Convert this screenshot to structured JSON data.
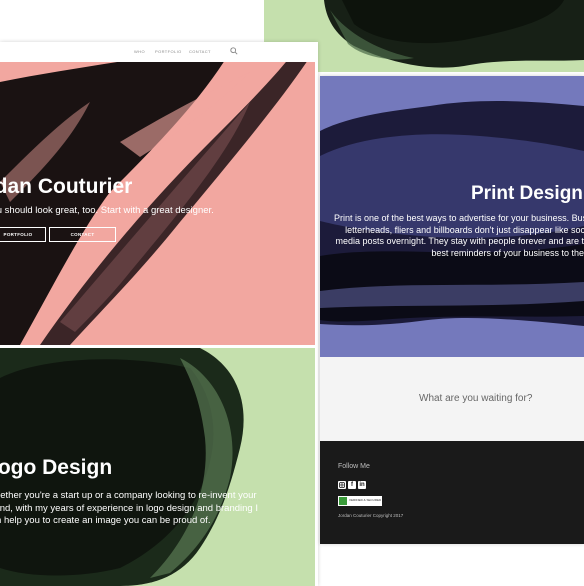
{
  "nav": {
    "items": [
      "WHO",
      "PORTFOLIO",
      "CONTACT"
    ]
  },
  "hero": {
    "title": "Jordan Couturier",
    "subtitle": "You should look great, too. Start with a great designer.",
    "buttons": [
      "PORTFOLIO",
      "CONTACT"
    ]
  },
  "logo_section": {
    "title": "Logo Design",
    "lines": [
      "Whether you're a start up or a company looking to re-invent your",
      "brand, with my years of experience in logo design and branding I",
      "can help you to create an image you can be proud of."
    ]
  },
  "print_section": {
    "title": "Print Design",
    "lines": [
      "Print is one of the best ways to advertise for your business. Business cards,",
      "letterheads, fliers and billboards don't just disappear like social",
      "media posts overnight. They stay with people forever and are the",
      "best reminders of your business to them."
    ]
  },
  "cta": {
    "text": "What are you waiting for?"
  },
  "footer": {
    "follow": "Follow Me",
    "social": [
      "instagram-icon",
      "facebook-icon",
      "linkedin-icon"
    ],
    "badge_text": "VERIFIED & SECURED",
    "copyright": "Jordan Couturier Copyright 2017"
  },
  "colors": {
    "hero_bg": "#f2a7a0",
    "logo_bg": "#c5e0ad",
    "print_bg": "#7479bc",
    "footer_bg": "#1a1a1a"
  }
}
